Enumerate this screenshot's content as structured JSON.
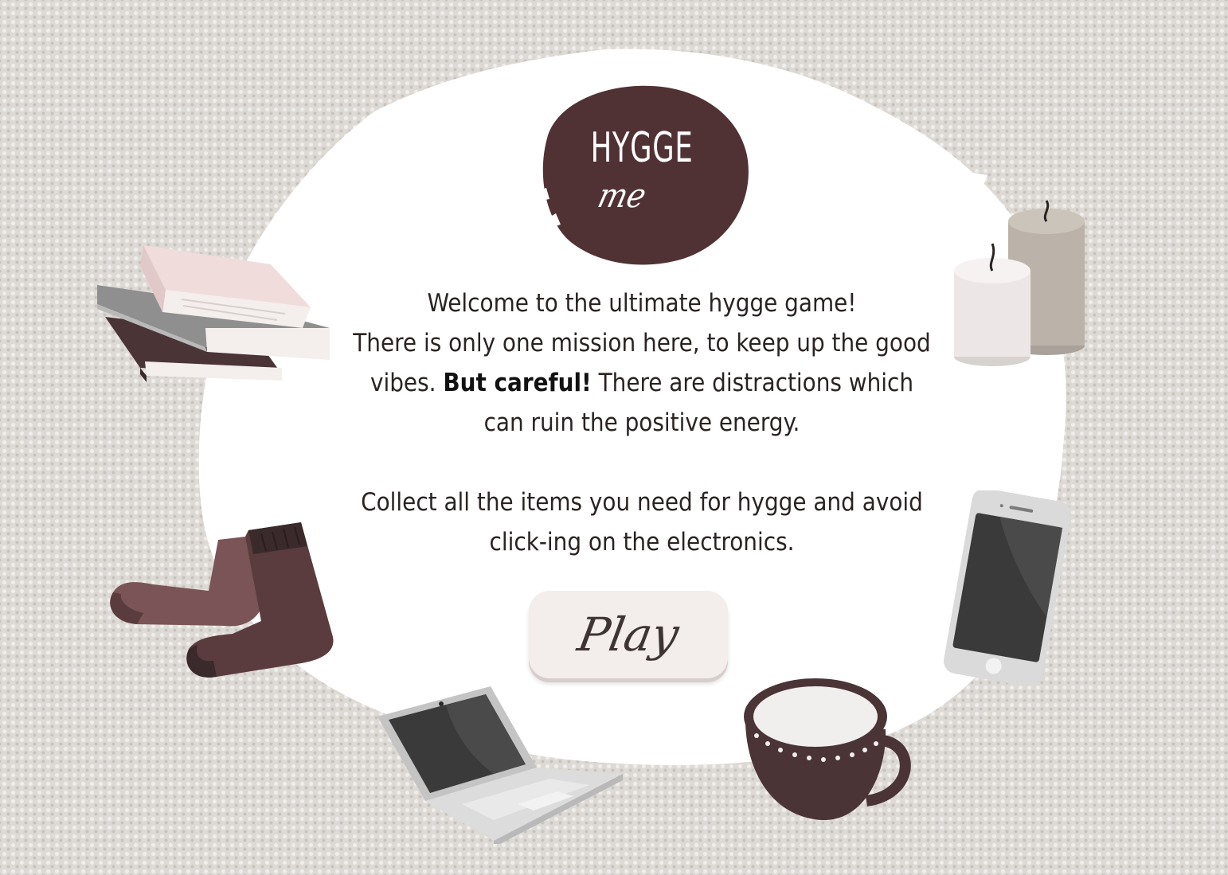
{
  "game": {
    "logo": {
      "title": "HYGGE",
      "subtitle": "me"
    },
    "intro": {
      "line1": "Welcome to the ultimate hygge game!",
      "line2_part1": "There is only one mission here, to keep up the good vibes.",
      "warning": "But careful!",
      "line2_part2": "There are distractions which can ruin the positive energy.",
      "line3": "Collect all the items you need for hygge and avoid click-ing on the electronics."
    },
    "play_button": {
      "label": "Play"
    },
    "items": {
      "books": "books-icon",
      "candles": "candles-icon",
      "socks": "socks-icon",
      "phone": "smartphone-icon",
      "laptop": "laptop-icon",
      "cup": "coffee-cup-icon"
    },
    "colors": {
      "brand": "#513234",
      "background": "#ddd9d4",
      "card": "#ffffff",
      "button": "#f3edeb",
      "text": "#2a2322"
    }
  }
}
